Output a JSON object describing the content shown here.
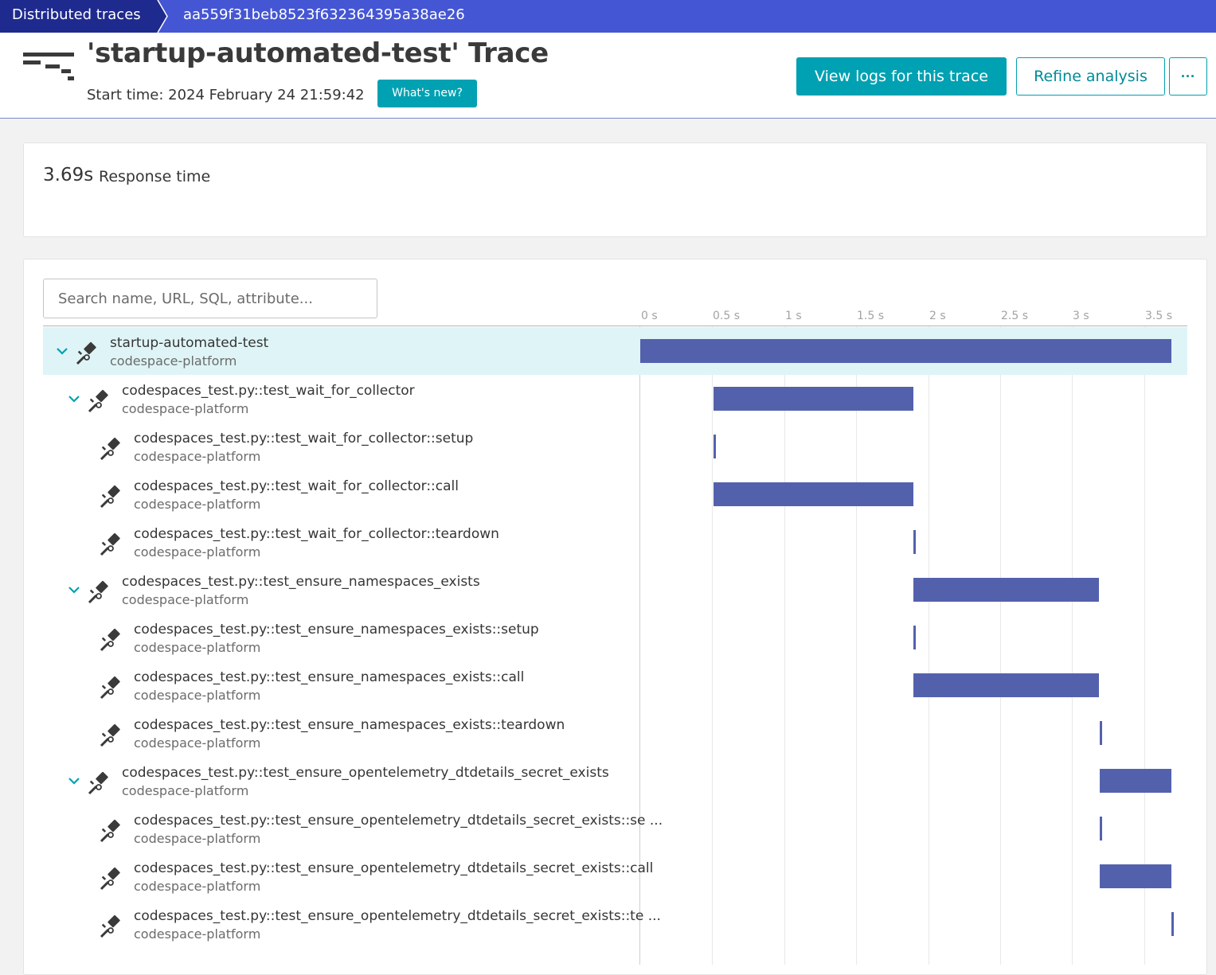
{
  "breadcrumb": {
    "items": [
      "Distributed traces",
      "aa559f31beb8523f632364395a38ae26"
    ]
  },
  "header": {
    "icon": "trace-waterfall-icon",
    "title": "'startup-automated-test' Trace",
    "start_time": "Start time: 2024 February 24 21:59:42",
    "whats_new": "What's new?",
    "view_logs": "View logs for this trace",
    "refine": "Refine analysis",
    "more": "···"
  },
  "response_time": {
    "value": "3.69s",
    "label": "Response time"
  },
  "search": {
    "placeholder": "Search name, URL, SQL, attribute..."
  },
  "timeline": {
    "max_seconds": 3.69,
    "ticks": [
      "0 s",
      "0.5 s",
      "1 s",
      "1.5 s",
      "2 s",
      "2.5 s",
      "3 s",
      "3.5 s"
    ],
    "tick_values": [
      0,
      0.5,
      1,
      1.5,
      2,
      2.5,
      3,
      3.5
    ]
  },
  "colors": {
    "accent": "#00a1b2",
    "bar": "#5361ad",
    "breadcrumb": "#4556d4",
    "selected_row": "#dff4f6"
  },
  "spans": [
    {
      "name": "startup-automated-test",
      "service": "codespace-platform",
      "level": 0,
      "expandable": true,
      "selected": true,
      "start_s": 0.0,
      "end_s": 3.69
    },
    {
      "name": "codespaces_test.py::test_wait_for_collector",
      "service": "codespace-platform",
      "level": 1,
      "expandable": true,
      "start_s": 0.51,
      "end_s": 1.9
    },
    {
      "name": "codespaces_test.py::test_wait_for_collector::setup",
      "service": "codespace-platform",
      "level": 2,
      "expandable": false,
      "start_s": 0.51,
      "end_s": 0.51
    },
    {
      "name": "codespaces_test.py::test_wait_for_collector::call",
      "service": "codespace-platform",
      "level": 2,
      "expandable": false,
      "start_s": 0.51,
      "end_s": 1.9
    },
    {
      "name": "codespaces_test.py::test_wait_for_collector::teardown",
      "service": "codespace-platform",
      "level": 2,
      "expandable": false,
      "start_s": 1.9,
      "end_s": 1.9
    },
    {
      "name": "codespaces_test.py::test_ensure_namespaces_exists",
      "service": "codespace-platform",
      "level": 1,
      "expandable": true,
      "start_s": 1.9,
      "end_s": 3.19
    },
    {
      "name": "codespaces_test.py::test_ensure_namespaces_exists::setup",
      "service": "codespace-platform",
      "level": 2,
      "expandable": false,
      "start_s": 1.9,
      "end_s": 1.9
    },
    {
      "name": "codespaces_test.py::test_ensure_namespaces_exists::call",
      "service": "codespace-platform",
      "level": 2,
      "expandable": false,
      "start_s": 1.9,
      "end_s": 3.19
    },
    {
      "name": "codespaces_test.py::test_ensure_namespaces_exists::teardown",
      "service": "codespace-platform",
      "level": 2,
      "expandable": false,
      "start_s": 3.19,
      "end_s": 3.19
    },
    {
      "name": "codespaces_test.py::test_ensure_opentelemetry_dtdetails_secret_exists",
      "service": "codespace-platform",
      "level": 1,
      "expandable": true,
      "start_s": 3.19,
      "end_s": 3.69
    },
    {
      "name": "codespaces_test.py::test_ensure_opentelemetry_dtdetails_secret_exists::se ...",
      "service": "codespace-platform",
      "level": 2,
      "expandable": false,
      "start_s": 3.19,
      "end_s": 3.19
    },
    {
      "name": "codespaces_test.py::test_ensure_opentelemetry_dtdetails_secret_exists::call",
      "service": "codespace-platform",
      "level": 2,
      "expandable": false,
      "start_s": 3.19,
      "end_s": 3.69
    },
    {
      "name": "codespaces_test.py::test_ensure_opentelemetry_dtdetails_secret_exists::te ...",
      "service": "codespace-platform",
      "level": 2,
      "expandable": false,
      "start_s": 3.69,
      "end_s": 3.69
    }
  ]
}
